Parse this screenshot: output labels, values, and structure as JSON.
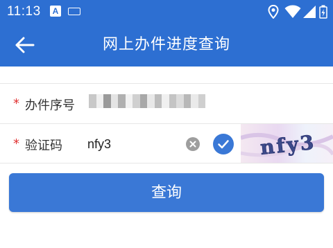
{
  "status_bar": {
    "time": "11:13",
    "left_icons": [
      "a-notification-icon",
      "keyboard-icon"
    ],
    "right_icons": [
      "location-icon",
      "wifi-icon",
      "signal-icon",
      "battery-icon"
    ]
  },
  "app_bar": {
    "title": "网上办件进度查询",
    "back_icon": "arrow-left-icon"
  },
  "form": {
    "required_mark": "*",
    "case_number": {
      "label": "办件序号",
      "value": "",
      "blurred": true
    },
    "captcha": {
      "label": "验证码",
      "value": "nfy3",
      "clear_icon": "clear-circle-icon",
      "confirm_icon": "check-circle-icon",
      "image_text": "nfy3"
    }
  },
  "submit": {
    "label": "查询"
  },
  "colors": {
    "primary": "#2d6fd2",
    "button": "#3a78d6",
    "required": "#e03131"
  }
}
